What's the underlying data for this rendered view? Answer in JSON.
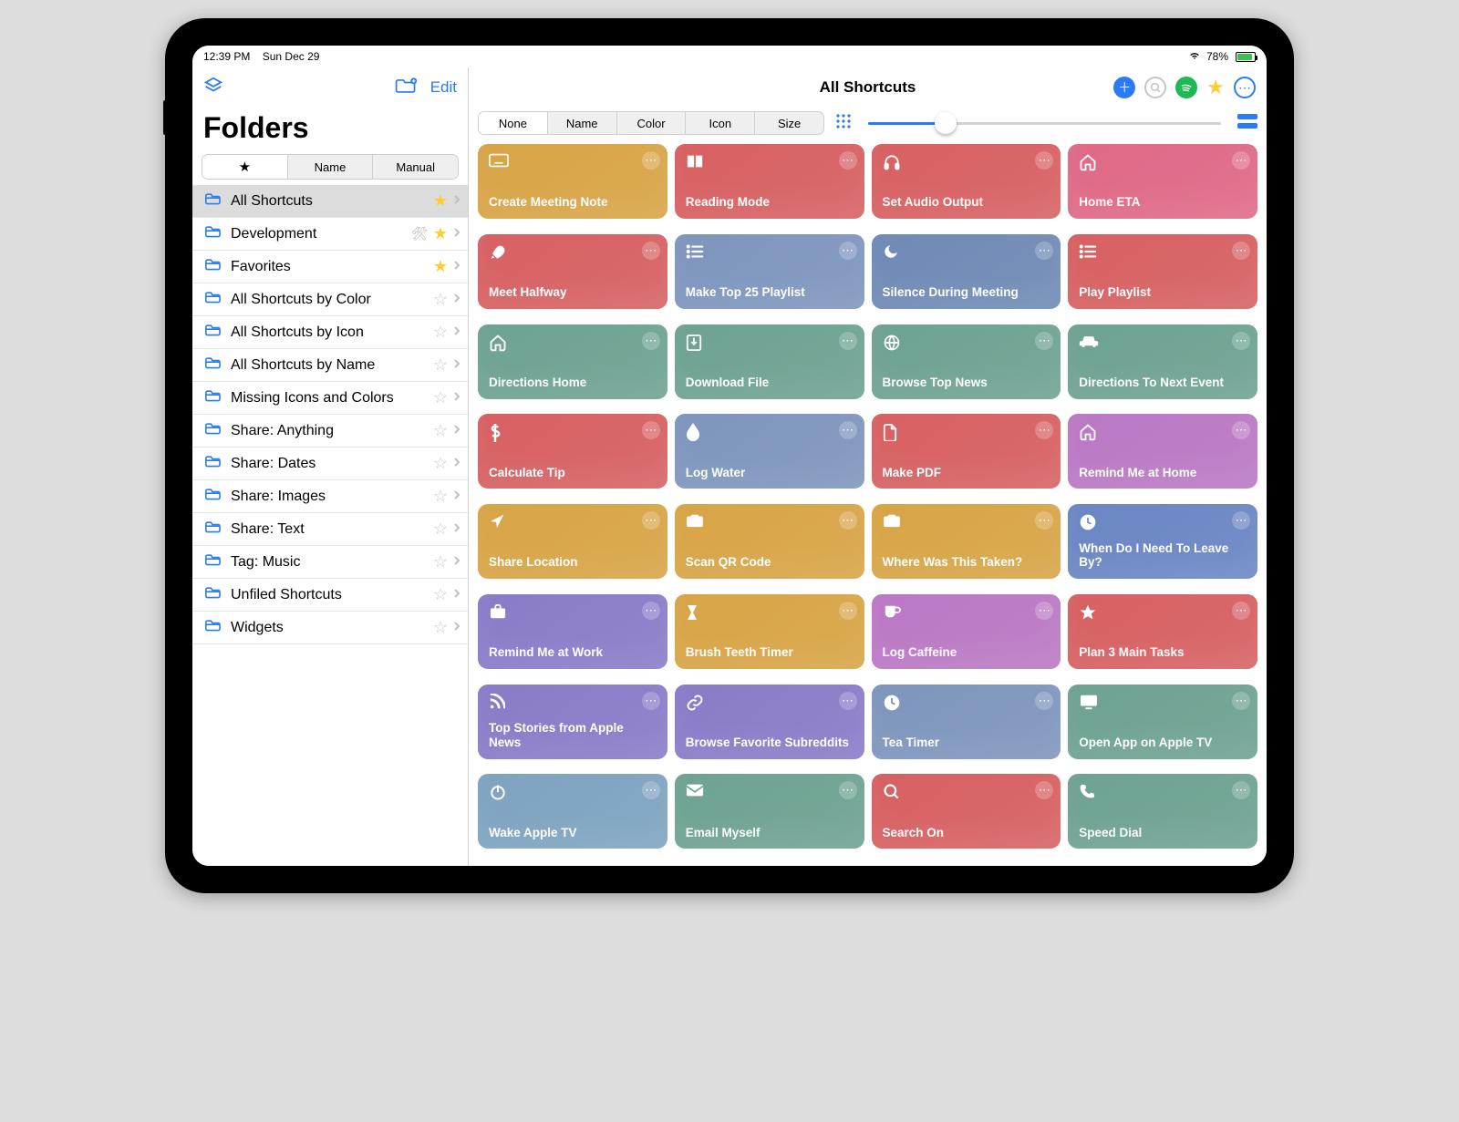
{
  "status": {
    "time": "12:39 PM",
    "date": "Sun Dec 29",
    "battery": "78%"
  },
  "sidebar": {
    "edit_label": "Edit",
    "title": "Folders",
    "seg": {
      "favorites": "★",
      "name": "Name",
      "manual": "Manual"
    },
    "items": [
      {
        "label": "All Shortcuts",
        "star": "gold",
        "selected": true,
        "wrench": false
      },
      {
        "label": "Development",
        "star": "gold",
        "selected": false,
        "wrench": true
      },
      {
        "label": "Favorites",
        "star": "gold",
        "selected": false,
        "wrench": false
      },
      {
        "label": "All Shortcuts by Color",
        "star": "gray",
        "selected": false,
        "wrench": false
      },
      {
        "label": "All Shortcuts by Icon",
        "star": "gray",
        "selected": false,
        "wrench": false
      },
      {
        "label": "All Shortcuts by Name",
        "star": "gray",
        "selected": false,
        "wrench": false
      },
      {
        "label": "Missing Icons and Colors",
        "star": "gray",
        "selected": false,
        "wrench": false
      },
      {
        "label": "Share: Anything",
        "star": "gray",
        "selected": false,
        "wrench": false
      },
      {
        "label": "Share: Dates",
        "star": "gray",
        "selected": false,
        "wrench": false
      },
      {
        "label": "Share: Images",
        "star": "gray",
        "selected": false,
        "wrench": false
      },
      {
        "label": "Share: Text",
        "star": "gray",
        "selected": false,
        "wrench": false
      },
      {
        "label": "Tag: Music",
        "star": "gray",
        "selected": false,
        "wrench": false
      },
      {
        "label": "Unfiled Shortcuts",
        "star": "gray",
        "selected": false,
        "wrench": false
      },
      {
        "label": "Widgets",
        "star": "gray",
        "selected": false,
        "wrench": false
      }
    ]
  },
  "main": {
    "title": "All Shortcuts",
    "sort": {
      "none": "None",
      "name": "Name",
      "color": "Color",
      "icon": "Icon",
      "size": "Size"
    },
    "tiles": [
      {
        "label": "Create Meeting Note",
        "color": "#d8a446",
        "icon": "keyboard"
      },
      {
        "label": "Reading Mode",
        "color": "#d76062",
        "icon": "book"
      },
      {
        "label": "Set Audio Output",
        "color": "#d76062",
        "icon": "headphones"
      },
      {
        "label": "Home ETA",
        "color": "#df6986",
        "icon": "house"
      },
      {
        "label": "Meet Halfway",
        "color": "#d76062",
        "icon": "rocket"
      },
      {
        "label": "Make Top 25 Playlist",
        "color": "#7e95bd",
        "icon": "list"
      },
      {
        "label": "Silence During Meeting",
        "color": "#6f8ab6",
        "icon": "moon"
      },
      {
        "label": "Play Playlist",
        "color": "#d76062",
        "icon": "list"
      },
      {
        "label": "Directions Home",
        "color": "#6ea292",
        "icon": "house"
      },
      {
        "label": "Download File",
        "color": "#6ea292",
        "icon": "download"
      },
      {
        "label": "Browse Top News",
        "color": "#6ea292",
        "icon": "globe"
      },
      {
        "label": "Directions To Next Event",
        "color": "#6ea292",
        "icon": "car"
      },
      {
        "label": "Calculate Tip",
        "color": "#d76062",
        "icon": "dollar"
      },
      {
        "label": "Log Water",
        "color": "#7e95bd",
        "icon": "drop"
      },
      {
        "label": "Make PDF",
        "color": "#d76062",
        "icon": "doc"
      },
      {
        "label": "Remind Me at Home",
        "color": "#ba78c4",
        "icon": "house"
      },
      {
        "label": "Share Location",
        "color": "#d8a446",
        "icon": "location"
      },
      {
        "label": "Scan QR Code",
        "color": "#d8a446",
        "icon": "camera"
      },
      {
        "label": "Where Was This Taken?",
        "color": "#d8a446",
        "icon": "camera"
      },
      {
        "label": "When Do I Need To Leave By?",
        "color": "#6a86c4",
        "icon": "clock"
      },
      {
        "label": "Remind Me at Work",
        "color": "#8a7bc8",
        "icon": "briefcase"
      },
      {
        "label": "Brush Teeth Timer",
        "color": "#d8a446",
        "icon": "hourglass"
      },
      {
        "label": "Log Caffeine",
        "color": "#ba78c4",
        "icon": "mug"
      },
      {
        "label": "Plan 3 Main Tasks",
        "color": "#d76062",
        "icon": "star"
      },
      {
        "label": "Top Stories from Apple News",
        "color": "#8a7bc8",
        "icon": "rss"
      },
      {
        "label": "Browse Favorite Subreddits",
        "color": "#8a7bc8",
        "icon": "link"
      },
      {
        "label": "Tea Timer",
        "color": "#7e95bd",
        "icon": "clock"
      },
      {
        "label": "Open App on Apple TV",
        "color": "#6ea292",
        "icon": "tv"
      },
      {
        "label": "Wake Apple TV",
        "color": "#7ea3c0",
        "icon": "power"
      },
      {
        "label": "Email Myself",
        "color": "#6ea292",
        "icon": "mail"
      },
      {
        "label": "Search On",
        "color": "#d76062",
        "icon": "search"
      },
      {
        "label": "Speed Dial",
        "color": "#6ea292",
        "icon": "phone"
      }
    ]
  }
}
